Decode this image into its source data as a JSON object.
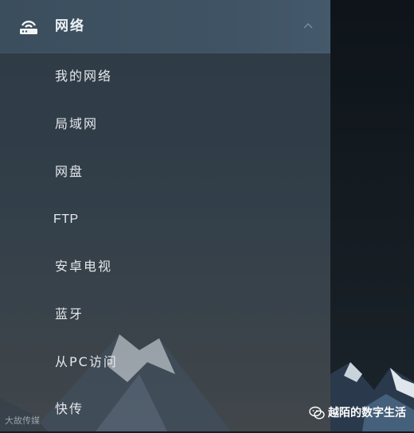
{
  "header": {
    "title": "网络",
    "icon": "router-icon",
    "collapse_icon": "chevron-up-icon"
  },
  "menu": {
    "items": [
      {
        "label": "我的网络"
      },
      {
        "label": "局域网"
      },
      {
        "label": "网盘"
      },
      {
        "label": "FTP"
      },
      {
        "label": "安卓电视"
      },
      {
        "label": "蓝牙"
      },
      {
        "label": "从PC访问"
      },
      {
        "label": "快传"
      }
    ]
  },
  "watermark": {
    "left_text": "大故传媒",
    "right_text": "越陌的数字生活",
    "right_icon": "wechat-icon"
  },
  "colors": {
    "header_bg": "#3f5364",
    "text": "#e4e8ec",
    "background": "#141c22"
  }
}
